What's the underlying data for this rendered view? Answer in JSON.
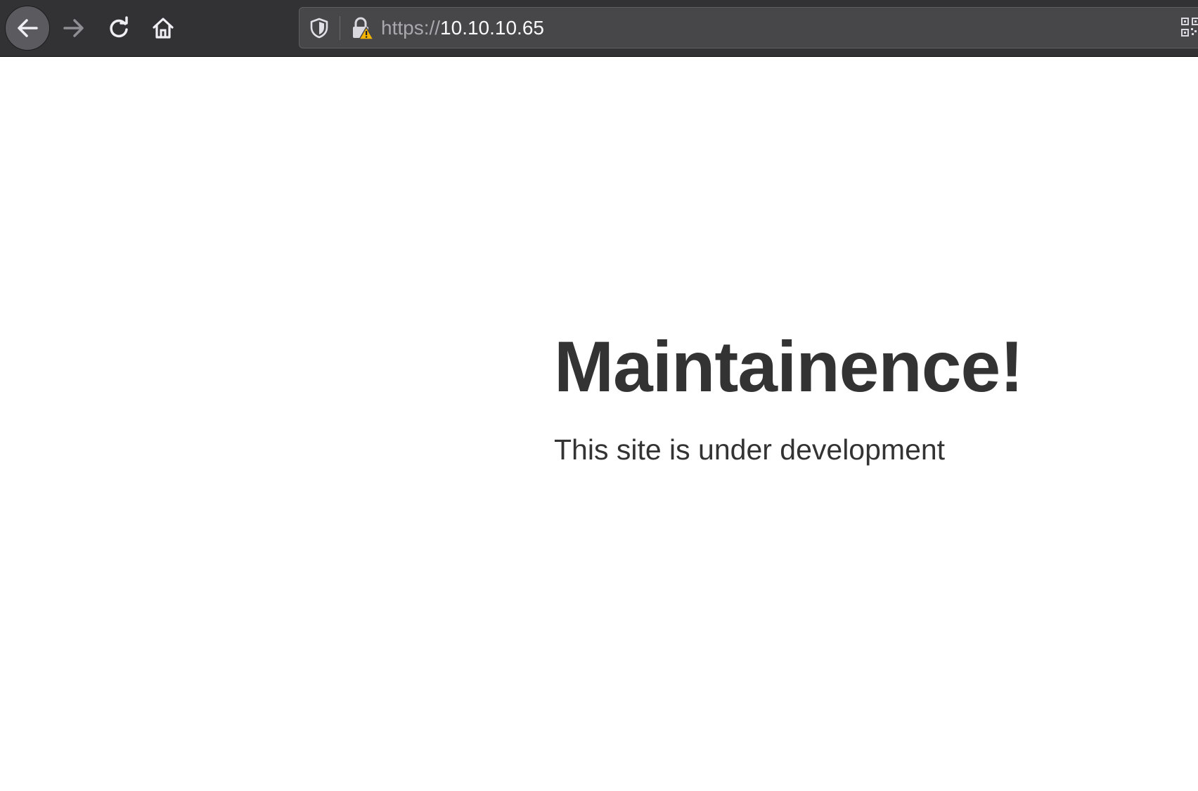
{
  "browser": {
    "nav": {
      "back_icon": "arrow-left-icon",
      "forward_icon": "arrow-right-icon",
      "reload_icon": "reload-icon",
      "home_icon": "home-icon"
    },
    "urlbar": {
      "scheme": "https://",
      "host": "10.10.10.65",
      "tracking_icon": "shield-icon",
      "security_icon": "insecure-lock-warning-icon",
      "extra_icon": "qr-code-icon"
    },
    "colors": {
      "toolbar_bg": "#323234",
      "urlbar_bg": "#474749",
      "warning": "#f5b400"
    }
  },
  "page": {
    "title": "Maintainence!",
    "subtitle": "This site is under development",
    "colors": {
      "text": "#333333",
      "background": "#ffffff"
    }
  }
}
